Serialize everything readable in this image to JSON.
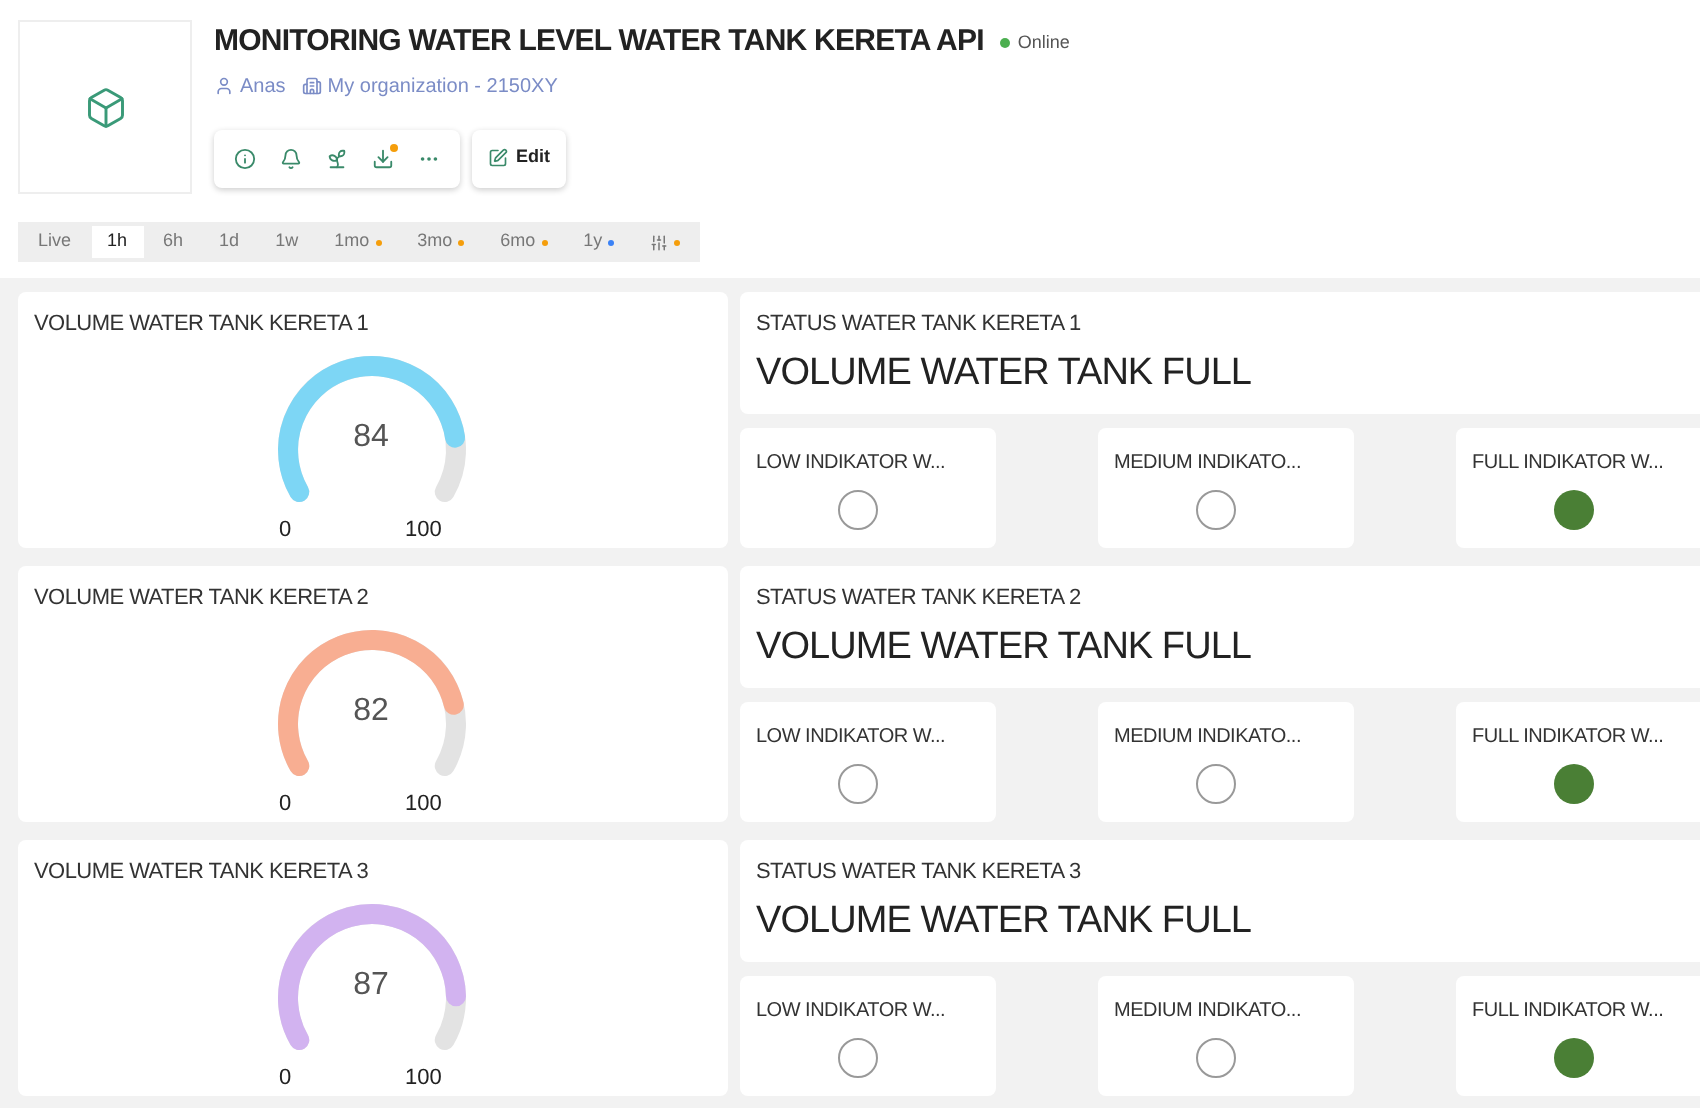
{
  "header": {
    "title": "MONITORING WATER LEVEL WATER TANK KERETA API",
    "status": "Online",
    "online": true,
    "owner": "Anas",
    "organization": "My organization - 2150XY",
    "edit_label": "Edit"
  },
  "time_tabs": [
    {
      "label": "Live",
      "selected": false
    },
    {
      "label": "1h",
      "selected": true
    },
    {
      "label": "6h",
      "selected": false
    },
    {
      "label": "1d",
      "selected": false
    },
    {
      "label": "1w",
      "selected": false
    },
    {
      "label": "1mo",
      "selected": false,
      "color": "#f59e0b"
    },
    {
      "label": "3mo",
      "selected": false,
      "color": "#f59e0b"
    },
    {
      "label": "6mo",
      "selected": false,
      "color": "#f59e0b"
    },
    {
      "label": "1y",
      "selected": false,
      "color": "#3b82f6"
    },
    {
      "kind": "filter",
      "selected": false,
      "color": "#f59e0b"
    }
  ],
  "tanks": [
    {
      "gauge": {
        "title": "VOLUME WATER TANK KERETA 1",
        "value": "84",
        "min": "0",
        "max": "100",
        "color": "#7dd6f5"
      },
      "status": {
        "title": "STATUS WATER TANK KERETA 1",
        "text": "VOLUME WATER TANK FULL"
      },
      "indicators": [
        {
          "label": "LOW INDIKATOR W...",
          "on": false
        },
        {
          "label": "MEDIUM INDIKATO...",
          "on": false
        },
        {
          "label": "FULL INDIKATOR W...",
          "on": true
        }
      ]
    },
    {
      "gauge": {
        "title": "VOLUME WATER TANK KERETA 2",
        "value": "82",
        "min": "0",
        "max": "100",
        "color": "#f8ae92"
      },
      "status": {
        "title": "STATUS WATER TANK KERETA 2",
        "text": "VOLUME WATER TANK FULL"
      },
      "indicators": [
        {
          "label": "LOW INDIKATOR W...",
          "on": false
        },
        {
          "label": "MEDIUM INDIKATO...",
          "on": false
        },
        {
          "label": "FULL INDIKATOR W...",
          "on": true
        }
      ]
    },
    {
      "gauge": {
        "title": "VOLUME WATER TANK KERETA 3",
        "value": "87",
        "min": "0",
        "max": "100",
        "color": "#d2b3f0"
      },
      "status": {
        "title": "STATUS WATER TANK KERETA 3",
        "text": "VOLUME WATER TANK FULL"
      },
      "indicators": [
        {
          "label": "LOW INDIKATOR W...",
          "on": false
        },
        {
          "label": "MEDIUM INDIKATO...",
          "on": false
        },
        {
          "label": "FULL INDIKATOR W...",
          "on": true
        }
      ]
    }
  ]
}
